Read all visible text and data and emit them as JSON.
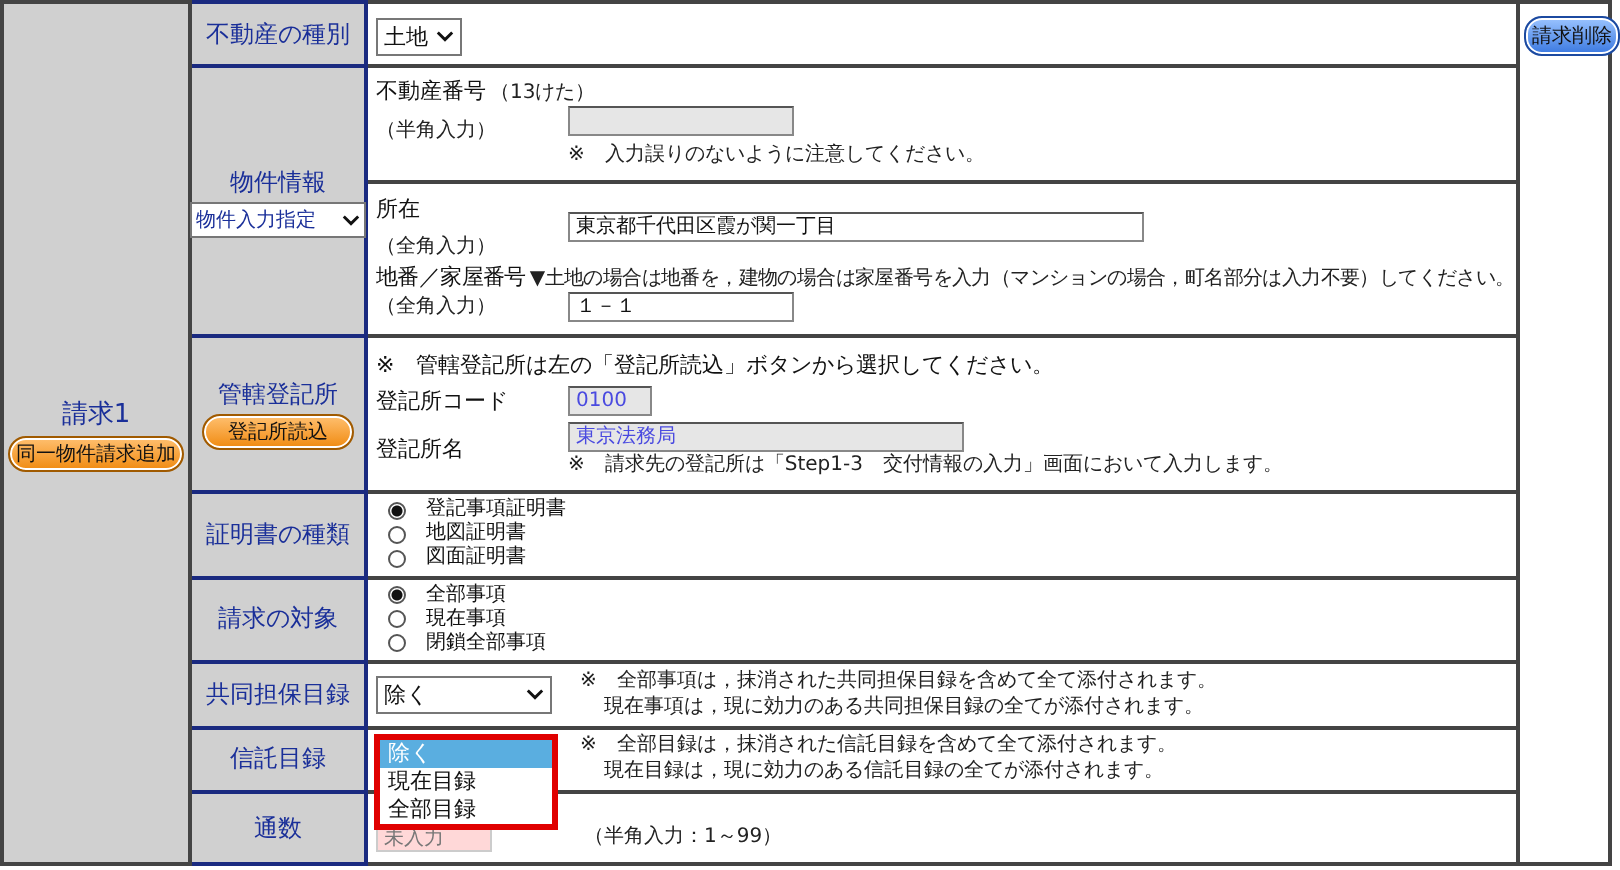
{
  "request": {
    "title": "請求1",
    "add_button": "同一物件請求追加",
    "delete_button": "請求削除"
  },
  "property_type": {
    "label": "不動産の種別",
    "value": "土地"
  },
  "property_info": {
    "label": "物件情報",
    "mode": "物件入力指定",
    "number": {
      "label": "不動産番号",
      "digits": "（13けた）",
      "hint": "（半角入力）",
      "note": "※　入力誤りのないように注意してください。"
    },
    "location": {
      "label": "所在",
      "hint": "（全角入力）",
      "value": "東京都千代田区霞が関一丁目"
    },
    "lot": {
      "label": "地番／家屋番号",
      "hint": "（全角入力）",
      "note": "▼土地の場合は地番を，建物の場合は家屋番号を入力（マンションの場合，町名部分は入力不要）してください。",
      "value": "１－１"
    }
  },
  "registry": {
    "label": "管轄登記所",
    "button": "登記所読込",
    "note": "※　管轄登記所は左の「登記所読込」ボタンから選択してください。",
    "code_label": "登記所コード",
    "code": "0100",
    "name_label": "登記所名",
    "name": "東京法務局",
    "name_note": "※　請求先の登記所は「Step1-3　交付情報の入力」画面において入力します。"
  },
  "certificate_type": {
    "label": "証明書の種類",
    "options": [
      {
        "label": "登記事項証明書",
        "selected": true
      },
      {
        "label": "地図証明書",
        "selected": false
      },
      {
        "label": "図面証明書",
        "selected": false
      }
    ]
  },
  "scope": {
    "label": "請求の対象",
    "options": [
      {
        "label": "全部事項",
        "selected": true
      },
      {
        "label": "現在事項",
        "selected": false
      },
      {
        "label": "閉鎖全部事項",
        "selected": false
      }
    ]
  },
  "joint_collateral": {
    "label": "共同担保目録",
    "value": "除く",
    "notes": [
      "※　全部事項は，抹消された共同担保目録を含めて全て添付されます。",
      "現在事項は，現に効力のある共同担保目録の全てが添付されます。"
    ]
  },
  "trust": {
    "label": "信託目録",
    "notes": [
      "※　全部目録は，抹消された信託目録を含めて全て添付されます。",
      "現在目録は，現に効力のある信託目録の全てが添付されます。"
    ],
    "options": [
      {
        "label": "除く",
        "selected": true
      },
      {
        "label": "現在目録",
        "selected": false
      },
      {
        "label": "全部目録",
        "selected": false
      }
    ]
  },
  "copies": {
    "label": "通数",
    "placeholder": "未入力",
    "hint": "（半角入力：1～99）"
  }
}
